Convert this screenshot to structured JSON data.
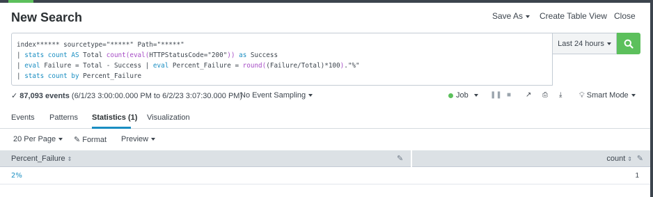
{
  "header": {
    "title": "New Search",
    "save_as": "Save As",
    "create_table_view": "Create Table View",
    "close": "Close"
  },
  "search": {
    "line1": "index****** sourcetype=\"*****\" Path=\"*****\"",
    "line2_pipe": "| ",
    "line2_kw": "stats count AS",
    "line2_a": " Total ",
    "line2_fn": "count(eval(",
    "line2_b": "HTTPStatusCode=\"200\"",
    "line2_fn2": "))",
    "line2_kw2": " as",
    "line2_c": " Success",
    "line3_pipe": "| ",
    "line3_kw": "eval",
    "line3_a": " Failure = Total - Success ",
    "line3_pipe2": "| ",
    "line3_kw2": "eval",
    "line3_b": " Percent_Failure = ",
    "line3_fn": "round(",
    "line3_c": "(Failure/Total)*100",
    "line3_fn2": ")",
    "line3_d": ".\"%\"",
    "line4_pipe": "| ",
    "line4_kw": "stats count by",
    "line4_a": " Percent_Failure"
  },
  "time_picker": {
    "label": "Last 24 hours"
  },
  "status": {
    "events": "87,093 events",
    "range": " (6/1/23 3:00:00.000 PM to 6/2/23 3:07:30.000 PM)",
    "sampling": "No Event Sampling",
    "job": "Job",
    "smart_mode": "Smart Mode"
  },
  "tabs": [
    {
      "label": "Events"
    },
    {
      "label": "Patterns"
    },
    {
      "label": "Statistics (1)"
    },
    {
      "label": "Visualization"
    }
  ],
  "toolbar": {
    "per_page": "20 Per Page",
    "format": "Format",
    "preview": "Preview"
  },
  "table": {
    "columns": [
      "Percent_Failure",
      "count"
    ],
    "rows": [
      {
        "percent_failure": "2%",
        "count": "1"
      }
    ]
  },
  "colors": {
    "accent_green": "#5cc05c",
    "link_blue": "#1a8ec2",
    "header_bg": "#dce1e5"
  }
}
